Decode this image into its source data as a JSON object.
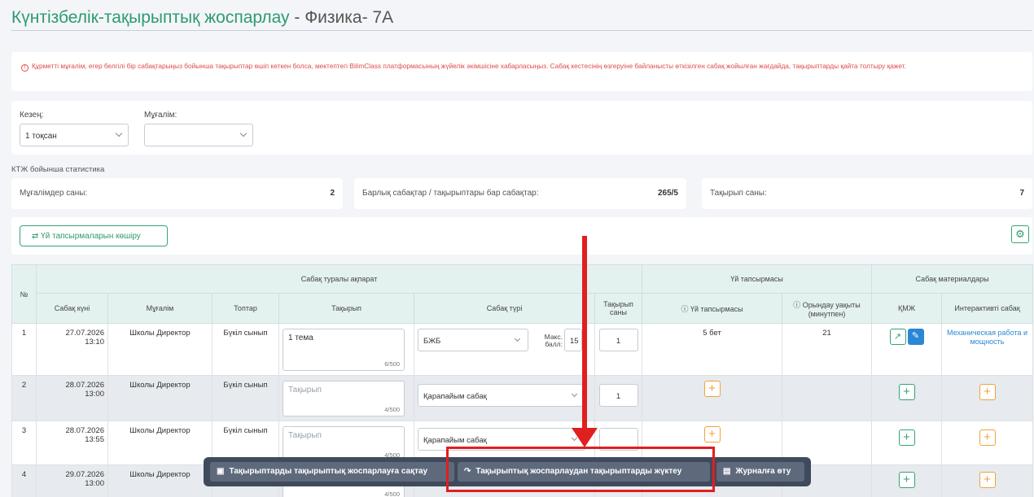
{
  "title": {
    "main": "Күнтізбелік-тақырыптық жоспарлау",
    "sep": " - ",
    "subject": "Физика- 7А"
  },
  "alert": {
    "icon": "info-icon",
    "text": "Құрметті мұғалім, егер белгілі бір сабақтарыңыз бойынша тақырыптар өшіп кеткен болса, мектептегі BilimClass платформасының жүйелік әкімшісіне хабарласыңыз. Сабақ кестесінің өзгеруіне байланысты өткізілген сабақ жойылған жағдайда, тақырыптарды қайта толтыру қажет."
  },
  "filters": {
    "period_label": "Кезең:",
    "period_value": "1 тоқсан",
    "teacher_label": "Мұғалім:",
    "teacher_value": ""
  },
  "stats": {
    "title": "КТЖ бойынша статистика",
    "teachers_label": "Мұғалімдер саны:",
    "teachers_value": "2",
    "lessons_label": "Барлық сабақтар / тақырыптары бар сабақтар:",
    "lessons_value": "265/5",
    "topics_label": "Тақырып саны:",
    "topics_value": "7"
  },
  "actions": {
    "copy_label": "Үй тапсырмаларын көшіру",
    "settings_icon": "gear-icon"
  },
  "table": {
    "h_num": "№",
    "h_lesson_info": "Сабақ туралы ақпарат",
    "h_homework": "Үй тапсырмасы",
    "h_materials": "Сабақ материалдары",
    "h_date": "Сабақ күні",
    "h_teacher": "Мұғалім",
    "h_groups": "Топтар",
    "h_topic": "Тақырып",
    "h_type": "Сабақ түрі",
    "h_topic_count": "Тақырып саны",
    "h_hw": "Үй тапсырмасы",
    "h_time": "Орындау уақыты (минутпен)",
    "h_kmj": "ҚМЖ",
    "h_interactive": "Интерактивті сабақ",
    "rows": [
      {
        "num": "1",
        "date": "27.07.2026",
        "time": "13:10",
        "teacher": "Школы Директор",
        "groups": "Бүкіл сынып",
        "topic": "1 тема",
        "topic_count_chars": "6/500",
        "type": "БЖБ",
        "max_label": "Макс. балл:",
        "max_value": "15",
        "topic_count": "1",
        "hw": "5 бет",
        "hw_time": "21",
        "interactive": "Механическая работа и мощность"
      },
      {
        "num": "2",
        "date": "28.07.2026",
        "time": "13:00",
        "teacher": "Школы Директор",
        "groups": "Бүкіл сынып",
        "topic_placeholder": "Тақырып",
        "topic_count_chars": "4/500",
        "type": "Қарапайым сабақ",
        "topic_count": "1"
      },
      {
        "num": "3",
        "date": "28.07.2026",
        "time": "13:55",
        "teacher": "Школы Директор",
        "groups": "Бүкіл сынып",
        "topic_placeholder": "Тақырып",
        "topic_count_chars": "4/500",
        "type": "Қарапайым сабақ",
        "topic_count": ""
      },
      {
        "num": "4",
        "date": "29.07.2026",
        "time": "13:00",
        "teacher": "Школы Директор",
        "topic_count_chars": "4/500"
      }
    ]
  },
  "floatbar": {
    "save_label": "Тақырыптарды тақырыптық жоспарлауға сақтау",
    "load_label": "Тақырыптық жоспарлаудан тақырыптарды жүктеу",
    "journal_label": "Журналға өту"
  },
  "colors": {
    "accent": "#2e9a6f",
    "highlight": "#e01f1f",
    "link": "#2a87d6",
    "plus_orange": "#f0a23a"
  }
}
